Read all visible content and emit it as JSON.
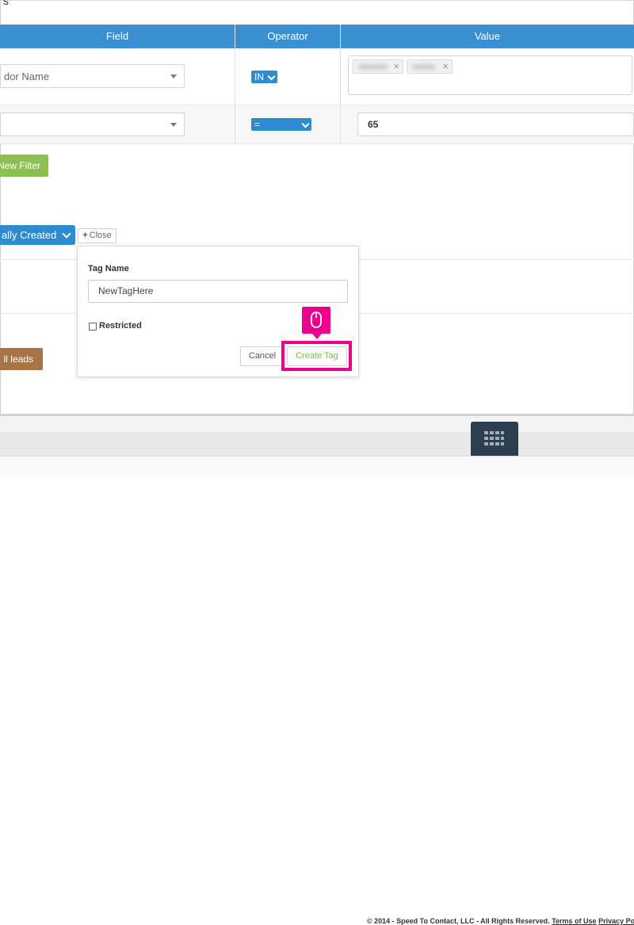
{
  "top_fragment": "s",
  "table": {
    "headers": {
      "field": "Field",
      "operator": "Operator",
      "value": "Value"
    },
    "row1": {
      "field": "dor Name",
      "operator": "IN"
    },
    "row2": {
      "field": "",
      "operator": "=",
      "value": "65"
    }
  },
  "buttons": {
    "new_filter": "New Filter",
    "tag_type": "ally Created",
    "close": "Close",
    "all_leads": "ll leads"
  },
  "popover": {
    "tag_name_label": "Tag Name",
    "tag_name_value": "NewTagHere",
    "restricted_label": "Restricted",
    "cancel": "Cancel",
    "create_tag": "Create Tag"
  },
  "footer": {
    "copyright": "© 2014 - Speed To Contact, LLC - All Rights Reserved.",
    "terms": "Terms of Use",
    "privacy": "Privacy Pol"
  },
  "colors": {
    "header_blue": "#3a8fd1",
    "green": "#8cc152",
    "brown": "#a97444",
    "highlight_magenta": "#ec008c",
    "dock": "#2e3e4e"
  }
}
